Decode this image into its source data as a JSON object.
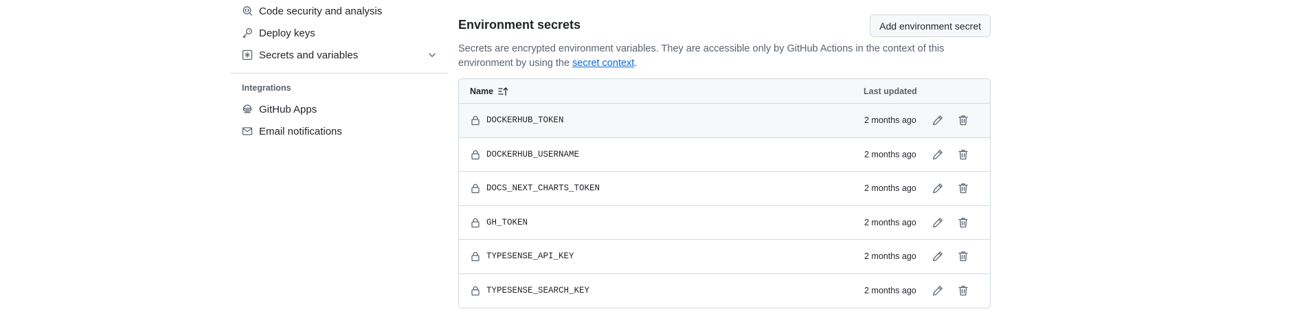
{
  "sidebar": {
    "items": [
      {
        "label": "Code security and analysis",
        "icon": "codescan-icon"
      },
      {
        "label": "Deploy keys",
        "icon": "key-icon"
      },
      {
        "label": "Secrets and variables",
        "icon": "key-asterisk-icon",
        "expandable": true
      }
    ],
    "integrations_heading": "Integrations",
    "integrations": [
      {
        "label": "GitHub Apps",
        "icon": "hubot-icon"
      },
      {
        "label": "Email notifications",
        "icon": "mail-icon"
      }
    ]
  },
  "main": {
    "title": "Environment secrets",
    "add_button": "Add environment secret",
    "description_prefix": "Secrets are encrypted environment variables. They are accessible only by GitHub Actions in the context of this environment by using the ",
    "description_link": "secret context",
    "description_suffix": ".",
    "table": {
      "col_name": "Name",
      "col_updated": "Last updated",
      "rows": [
        {
          "name": "DOCKERHUB_TOKEN",
          "updated": "2 months ago"
        },
        {
          "name": "DOCKERHUB_USERNAME",
          "updated": "2 months ago"
        },
        {
          "name": "DOCS_NEXT_CHARTS_TOKEN",
          "updated": "2 months ago"
        },
        {
          "name": "GH_TOKEN",
          "updated": "2 months ago"
        },
        {
          "name": "TYPESENSE_API_KEY",
          "updated": "2 months ago"
        },
        {
          "name": "TYPESENSE_SEARCH_KEY",
          "updated": "2 months ago"
        }
      ]
    }
  },
  "colors": {
    "link": "#0969da",
    "muted": "#59636e",
    "border": "#d1d9e0",
    "subtle_bg": "#f6f8fa"
  }
}
